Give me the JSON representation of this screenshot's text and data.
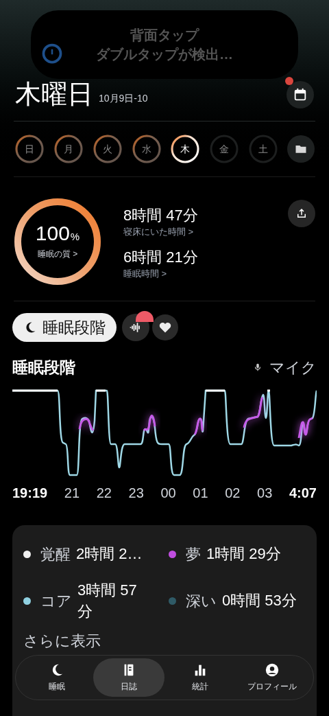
{
  "notification": {
    "title": "背面タップ",
    "message": "ダブルタップが検出…"
  },
  "header": {
    "title": "木曜日",
    "date_range": "10月9日-10",
    "calendar_badge": true
  },
  "days": [
    {
      "label": "日",
      "scored": true,
      "selected": false
    },
    {
      "label": "月",
      "scored": true,
      "selected": false
    },
    {
      "label": "火",
      "scored": true,
      "selected": false
    },
    {
      "label": "水",
      "scored": true,
      "selected": false
    },
    {
      "label": "木",
      "scored": true,
      "selected": true
    },
    {
      "label": "金",
      "scored": false,
      "selected": false
    },
    {
      "label": "土",
      "scored": false,
      "selected": false
    }
  ],
  "summary": {
    "quality": {
      "value": "100",
      "unit": "%",
      "label": "睡眠の質 >"
    },
    "stats": [
      {
        "value": "8時間 47分",
        "label": "寝床にいた時間 >"
      },
      {
        "value": "6時間 21分",
        "label": "睡眠時間 >"
      }
    ]
  },
  "view_tabs": [
    {
      "kind": "pill",
      "label": "睡眠段階",
      "selected": true
    },
    {
      "kind": "sound",
      "selected": false,
      "badge": true
    },
    {
      "kind": "heart",
      "selected": false
    }
  ],
  "chart": {
    "title": "睡眠段階",
    "source": "マイク",
    "x_labels": [
      "19:19",
      "21",
      "22",
      "23",
      "00",
      "01",
      "02",
      "03",
      "4:07"
    ]
  },
  "legend": [
    {
      "label": "覚醒",
      "value": "2時間 2…",
      "color": "#f0f0f0"
    },
    {
      "label": "夢",
      "value": "1時間 29分",
      "color": "#c04ee0"
    },
    {
      "label": "コア",
      "value": "3時間 57分",
      "color": "#8fd0e0"
    },
    {
      "label": "深い",
      "value": "0時間 53分",
      "color": "#2f5a66"
    }
  ],
  "more_link": "さらに表示",
  "nav": [
    {
      "kind": "moon",
      "label": "睡眠",
      "selected": false
    },
    {
      "kind": "journal",
      "label": "日誌",
      "selected": true
    },
    {
      "kind": "stats",
      "label": "統計",
      "selected": false
    },
    {
      "kind": "profile",
      "label": "プロフィール",
      "selected": false
    }
  ]
}
